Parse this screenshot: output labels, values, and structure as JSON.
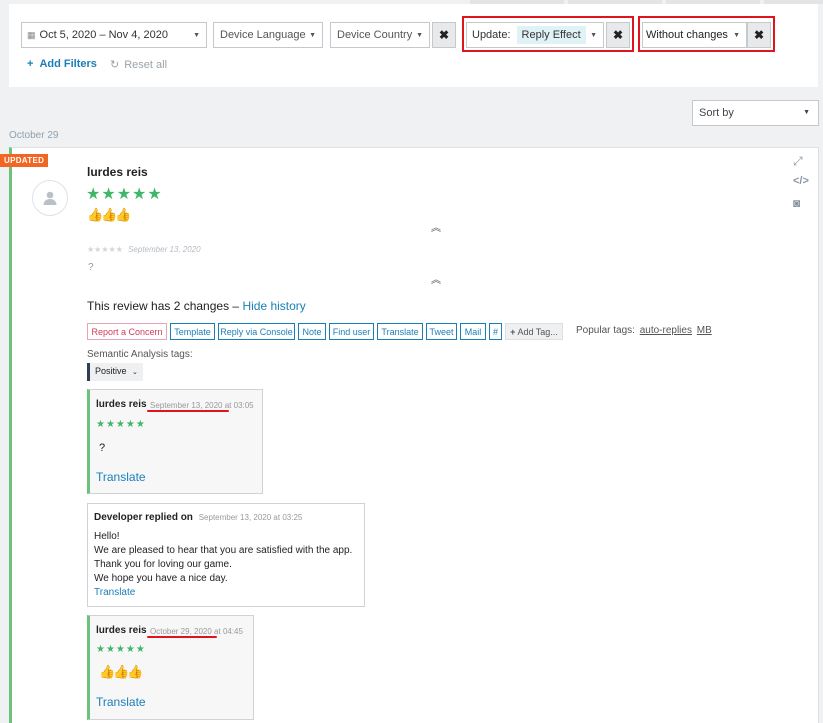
{
  "filters": {
    "date_range": "Oct 5, 2020 – Nov 4, 2020",
    "device_language": "Device Language",
    "device_country": "Device Country",
    "update_label": "Update:",
    "update_value": "Reply Effect",
    "changes_value": "Without changes",
    "add_filters": "Add Filters",
    "reset_all": "Reset all",
    "remove_glyph": "✖"
  },
  "sort": {
    "label": "Sort by"
  },
  "date_group": "October 29",
  "review": {
    "badge": "UPDATED",
    "author": "lurdes reis",
    "stars": "★★★★★",
    "body": "👍👍👍",
    "prev_stars": "★★★★★",
    "prev_date": "September 13, 2020",
    "prev_body": "?",
    "changes_text": "This review has 2 changes –",
    "hide_history": "Hide history",
    "actions": [
      "Report a Concern",
      "Template",
      "Reply via Console",
      "Note",
      "Find user",
      "Translate",
      "Tweet",
      "Mail",
      "#",
      "Add Tag..."
    ],
    "popular_tags_label": "Popular tags:",
    "popular_tags": [
      "auto-replies",
      "MB"
    ],
    "semantic_label": "Semantic Analysis tags:",
    "semantic_value": "Positive"
  },
  "history": [
    {
      "author": "lurdes reis",
      "date": "September 13, 2020 at 03:05",
      "stars": "★★★★★",
      "body": "?",
      "translate": "Translate"
    },
    {
      "author": "lurdes reis",
      "date": "October 29, 2020 at 04:45",
      "stars": "★★★★★",
      "body": "👍👍👍",
      "translate": "Translate"
    }
  ],
  "developer_reply": {
    "header": "Developer replied on",
    "date": "September 13, 2020 at 03:25",
    "lines": [
      "Hello!",
      "We are pleased to hear that you are satisfied with the app.",
      "Thank you for loving our game.",
      "We hope you have a nice day."
    ],
    "translate": "Translate"
  },
  "colors": {
    "accent": "#1a7fb8",
    "star_green": "#3fb768",
    "highlight_red": "#e0141c",
    "updated_orange": "#f26522",
    "left_border_green": "#6cc27a"
  },
  "icons": [
    "calendar-icon",
    "plus-icon",
    "reset-icon",
    "expand-icon",
    "code-icon",
    "camera-icon",
    "collapse-up-icon",
    "avatar-icon"
  ]
}
